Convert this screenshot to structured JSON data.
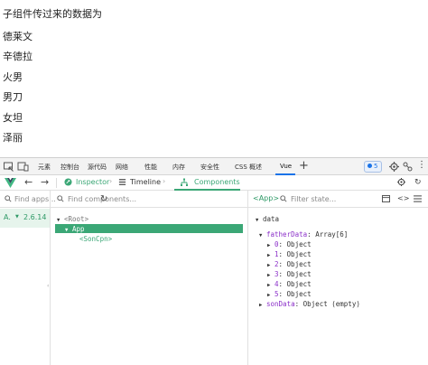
{
  "page": {
    "heading": "子组件传过来的数据为",
    "items": [
      "德莱文",
      "辛德拉",
      "火男",
      "男刀",
      "女坦",
      "泽丽"
    ]
  },
  "devtools_tabs": {
    "tabs": [
      "元素",
      "控制台",
      "源代码",
      "网络",
      "性能",
      "内存",
      "安全性",
      "CSS 概述",
      "Vue"
    ],
    "active": "Vue",
    "issues_count": "5"
  },
  "vue_toolbar": {
    "inspector_label": "Inspector",
    "timeline_label": "Timeline",
    "components_label": "Components"
  },
  "search": {
    "apps_placeholder": "Find apps...",
    "components_placeholder": "Find components...",
    "selected_component": "<App>",
    "state_placeholder": "Filter state..."
  },
  "app_list": {
    "app_letter": "A.",
    "version": "2.6.14"
  },
  "tree": {
    "root": "<Root>",
    "app": "App",
    "child": "<SonCpn>"
  },
  "state": {
    "section": "data",
    "father_key": "fatherData",
    "father_value": "Array[6]",
    "father_items": [
      {
        "key": "0",
        "value": "Object"
      },
      {
        "key": "1",
        "value": "Object"
      },
      {
        "key": "2",
        "value": "Object"
      },
      {
        "key": "3",
        "value": "Object"
      },
      {
        "key": "4",
        "value": "Object"
      },
      {
        "key": "5",
        "value": "Object"
      }
    ],
    "son_key": "sonData",
    "son_value": "Object (empty)"
  },
  "colors": {
    "vue_green": "#3ba776",
    "chrome_blue": "#1a73e8",
    "key_purple": "#8b2fc9"
  }
}
